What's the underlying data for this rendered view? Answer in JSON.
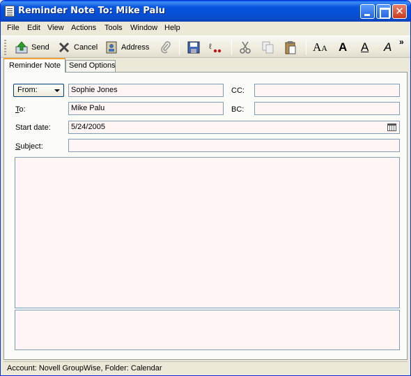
{
  "window": {
    "title": "Reminder Note To: Mike Palu"
  },
  "menu": [
    "File",
    "Edit",
    "View",
    "Actions",
    "Tools",
    "Window",
    "Help"
  ],
  "toolbar": {
    "send_label": "Send",
    "cancel_label": "Cancel",
    "address_label": "Address",
    "more_glyph": "»"
  },
  "tabs": {
    "active": "Reminder Note",
    "inactive": "Send Options"
  },
  "form": {
    "from_label": "From:",
    "from_value": "Sophie Jones",
    "to_label": "To:",
    "to_value": "Mike Palu",
    "cc_label": "CC:",
    "cc_value": "",
    "bc_label": "BC:",
    "bc_value": "",
    "start_date_label": "Start date:",
    "start_date_value": "5/24/2005",
    "subject_label": "Subject:",
    "subject_value": ""
  },
  "status": {
    "text": "Account: Novell GroupWise,  Folder: Calendar"
  },
  "colors": {
    "titlebar": "#0855dd",
    "field_bg": "#fff5f5",
    "tab_accent": "#f2a43a"
  }
}
